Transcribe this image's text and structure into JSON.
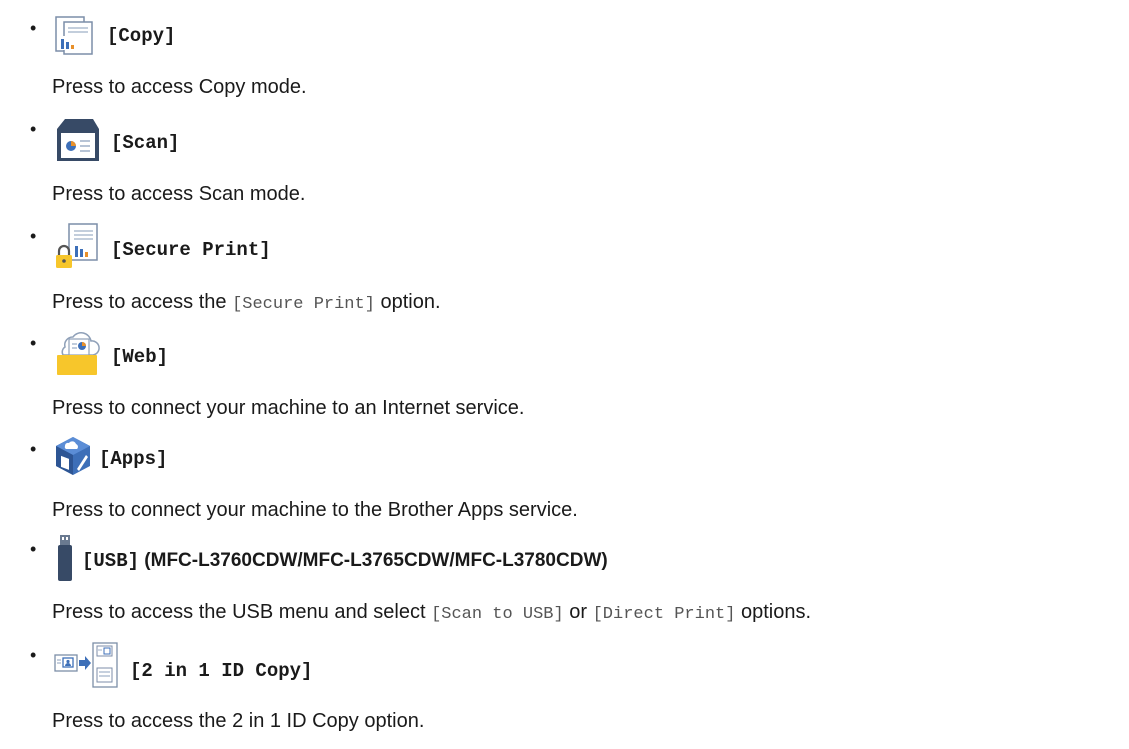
{
  "items": [
    {
      "icon": "copy-icon",
      "label": "[Copy]",
      "desc": "Press to access Copy mode."
    },
    {
      "icon": "scan-icon",
      "label": "[Scan]",
      "desc": "Press to access Scan mode."
    },
    {
      "icon": "secure-print-icon",
      "label": "[Secure Print]",
      "desc_pre": "Press to access the ",
      "desc_code": "[Secure Print]",
      "desc_post": " option."
    },
    {
      "icon": "web-icon",
      "label": "[Web]",
      "desc": "Press to connect your machine to an Internet service."
    },
    {
      "icon": "apps-icon",
      "label": "[Apps]",
      "desc": "Press to connect your machine to the Brother Apps service."
    },
    {
      "icon": "usb-icon",
      "label": "[USB]",
      "label_extra": " (MFC-L3760CDW/MFC-L3765CDW/MFC-L3780CDW)",
      "desc_pre": "Press to access the USB menu and select ",
      "desc_code1": "[Scan to USB]",
      "desc_mid": " or ",
      "desc_code2": "[Direct Print]",
      "desc_post": " options."
    },
    {
      "icon": "id-copy-icon",
      "label": "[2 in 1 ID Copy]",
      "desc": "Press to access the 2 in 1 ID Copy option."
    }
  ],
  "colors": {
    "text": "#1a1a1a",
    "mono_text": "#555555",
    "icon_blue": "#3d6fb8",
    "icon_dark": "#374a66",
    "icon_yellow": "#f7c62b",
    "icon_orange": "#e8902a"
  }
}
